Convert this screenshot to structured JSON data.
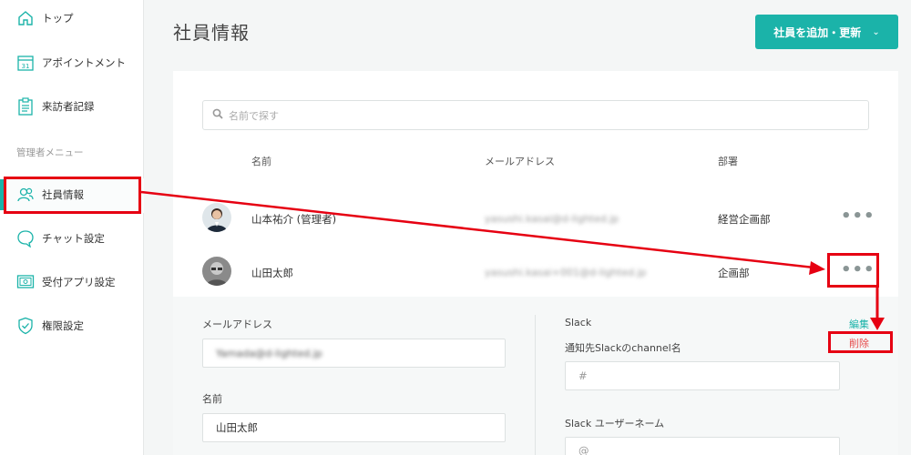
{
  "sidebar": {
    "items": [
      {
        "label": "トップ",
        "icon": "home-icon"
      },
      {
        "label": "アポイントメント",
        "icon": "calendar-icon",
        "icon_text": "31"
      },
      {
        "label": "来訪者記録",
        "icon": "clipboard-icon"
      },
      {
        "label": "社員情報",
        "icon": "users-icon"
      },
      {
        "label": "チャット設定",
        "icon": "chat-icon"
      },
      {
        "label": "受付アプリ設定",
        "icon": "tablet-icon"
      },
      {
        "label": "権限設定",
        "icon": "shield-icon"
      }
    ],
    "section_admin": "管理者メニュー"
  },
  "header": {
    "title": "社員情報",
    "add_button": "社員を追加・更新"
  },
  "search": {
    "placeholder": "名前で探す"
  },
  "table": {
    "columns": [
      "名前",
      "メールアドレス",
      "部署"
    ],
    "rows": [
      {
        "name": "山本祐介 (管理者)",
        "email": "yasushi.kasai@d-lighted.jp",
        "dept": "経営企画部"
      },
      {
        "name": "山田太郎",
        "email": "yasushi.kasai+001@d-lighted.jp",
        "dept": "企画部"
      }
    ]
  },
  "detail": {
    "email_label": "メールアドレス",
    "email_value": "Yamada@d-lighted.jp",
    "name_label": "名前",
    "name_value": "山田太郎",
    "slack_label": "Slack",
    "channel_label": "通知先Slackのchannel名",
    "channel_placeholder": "#",
    "slack_user_label": "Slack ユーザーネーム",
    "slack_user_placeholder": "@",
    "edit_link": "編集",
    "delete_link": "削除"
  },
  "colors": {
    "accent": "#1bb3a9",
    "annotation": "#e60012",
    "danger": "#e54b4b"
  }
}
